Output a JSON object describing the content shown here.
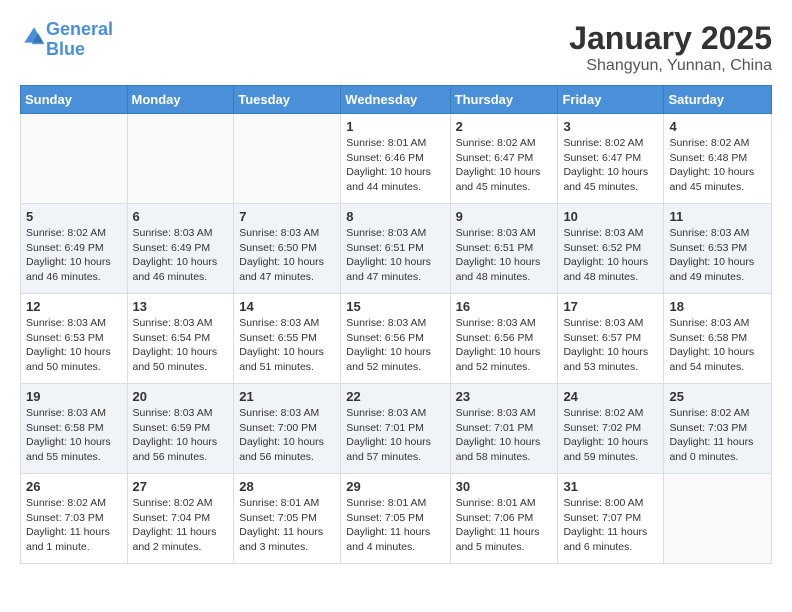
{
  "header": {
    "logo_line1": "General",
    "logo_line2": "Blue",
    "title": "January 2025",
    "subtitle": "Shangyun, Yunnan, China"
  },
  "weekdays": [
    "Sunday",
    "Monday",
    "Tuesday",
    "Wednesday",
    "Thursday",
    "Friday",
    "Saturday"
  ],
  "weeks": [
    [
      {
        "day": "",
        "info": ""
      },
      {
        "day": "",
        "info": ""
      },
      {
        "day": "",
        "info": ""
      },
      {
        "day": "1",
        "info": "Sunrise: 8:01 AM\nSunset: 6:46 PM\nDaylight: 10 hours\nand 44 minutes."
      },
      {
        "day": "2",
        "info": "Sunrise: 8:02 AM\nSunset: 6:47 PM\nDaylight: 10 hours\nand 45 minutes."
      },
      {
        "day": "3",
        "info": "Sunrise: 8:02 AM\nSunset: 6:47 PM\nDaylight: 10 hours\nand 45 minutes."
      },
      {
        "day": "4",
        "info": "Sunrise: 8:02 AM\nSunset: 6:48 PM\nDaylight: 10 hours\nand 45 minutes."
      }
    ],
    [
      {
        "day": "5",
        "info": "Sunrise: 8:02 AM\nSunset: 6:49 PM\nDaylight: 10 hours\nand 46 minutes."
      },
      {
        "day": "6",
        "info": "Sunrise: 8:03 AM\nSunset: 6:49 PM\nDaylight: 10 hours\nand 46 minutes."
      },
      {
        "day": "7",
        "info": "Sunrise: 8:03 AM\nSunset: 6:50 PM\nDaylight: 10 hours\nand 47 minutes."
      },
      {
        "day": "8",
        "info": "Sunrise: 8:03 AM\nSunset: 6:51 PM\nDaylight: 10 hours\nand 47 minutes."
      },
      {
        "day": "9",
        "info": "Sunrise: 8:03 AM\nSunset: 6:51 PM\nDaylight: 10 hours\nand 48 minutes."
      },
      {
        "day": "10",
        "info": "Sunrise: 8:03 AM\nSunset: 6:52 PM\nDaylight: 10 hours\nand 48 minutes."
      },
      {
        "day": "11",
        "info": "Sunrise: 8:03 AM\nSunset: 6:53 PM\nDaylight: 10 hours\nand 49 minutes."
      }
    ],
    [
      {
        "day": "12",
        "info": "Sunrise: 8:03 AM\nSunset: 6:53 PM\nDaylight: 10 hours\nand 50 minutes."
      },
      {
        "day": "13",
        "info": "Sunrise: 8:03 AM\nSunset: 6:54 PM\nDaylight: 10 hours\nand 50 minutes."
      },
      {
        "day": "14",
        "info": "Sunrise: 8:03 AM\nSunset: 6:55 PM\nDaylight: 10 hours\nand 51 minutes."
      },
      {
        "day": "15",
        "info": "Sunrise: 8:03 AM\nSunset: 6:56 PM\nDaylight: 10 hours\nand 52 minutes."
      },
      {
        "day": "16",
        "info": "Sunrise: 8:03 AM\nSunset: 6:56 PM\nDaylight: 10 hours\nand 52 minutes."
      },
      {
        "day": "17",
        "info": "Sunrise: 8:03 AM\nSunset: 6:57 PM\nDaylight: 10 hours\nand 53 minutes."
      },
      {
        "day": "18",
        "info": "Sunrise: 8:03 AM\nSunset: 6:58 PM\nDaylight: 10 hours\nand 54 minutes."
      }
    ],
    [
      {
        "day": "19",
        "info": "Sunrise: 8:03 AM\nSunset: 6:58 PM\nDaylight: 10 hours\nand 55 minutes."
      },
      {
        "day": "20",
        "info": "Sunrise: 8:03 AM\nSunset: 6:59 PM\nDaylight: 10 hours\nand 56 minutes."
      },
      {
        "day": "21",
        "info": "Sunrise: 8:03 AM\nSunset: 7:00 PM\nDaylight: 10 hours\nand 56 minutes."
      },
      {
        "day": "22",
        "info": "Sunrise: 8:03 AM\nSunset: 7:01 PM\nDaylight: 10 hours\nand 57 minutes."
      },
      {
        "day": "23",
        "info": "Sunrise: 8:03 AM\nSunset: 7:01 PM\nDaylight: 10 hours\nand 58 minutes."
      },
      {
        "day": "24",
        "info": "Sunrise: 8:02 AM\nSunset: 7:02 PM\nDaylight: 10 hours\nand 59 minutes."
      },
      {
        "day": "25",
        "info": "Sunrise: 8:02 AM\nSunset: 7:03 PM\nDaylight: 11 hours\nand 0 minutes."
      }
    ],
    [
      {
        "day": "26",
        "info": "Sunrise: 8:02 AM\nSunset: 7:03 PM\nDaylight: 11 hours\nand 1 minute."
      },
      {
        "day": "27",
        "info": "Sunrise: 8:02 AM\nSunset: 7:04 PM\nDaylight: 11 hours\nand 2 minutes."
      },
      {
        "day": "28",
        "info": "Sunrise: 8:01 AM\nSunset: 7:05 PM\nDaylight: 11 hours\nand 3 minutes."
      },
      {
        "day": "29",
        "info": "Sunrise: 8:01 AM\nSunset: 7:05 PM\nDaylight: 11 hours\nand 4 minutes."
      },
      {
        "day": "30",
        "info": "Sunrise: 8:01 AM\nSunset: 7:06 PM\nDaylight: 11 hours\nand 5 minutes."
      },
      {
        "day": "31",
        "info": "Sunrise: 8:00 AM\nSunset: 7:07 PM\nDaylight: 11 hours\nand 6 minutes."
      },
      {
        "day": "",
        "info": ""
      }
    ]
  ]
}
